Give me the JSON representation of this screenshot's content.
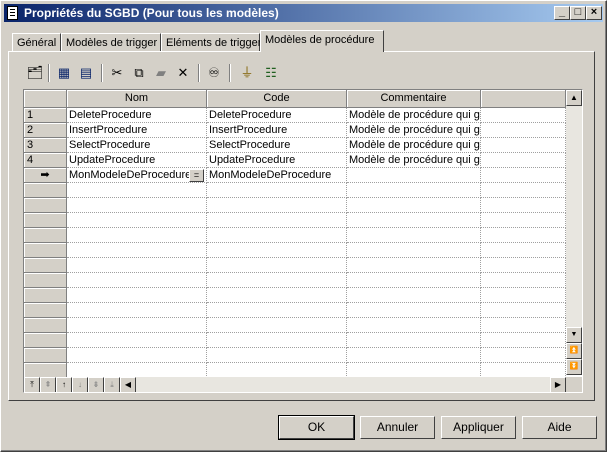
{
  "window": {
    "title": "Propriétés du SGBD (Pour tous les modèles)"
  },
  "tabs": [
    {
      "label": "Général"
    },
    {
      "label": "Modèles de trigger"
    },
    {
      "label": "Eléments de trigger"
    },
    {
      "label": "Modèles de procédure"
    }
  ],
  "active_tab": "Modèles de procédure",
  "toolbar": {
    "icons": [
      "properties-icon",
      "add-row-icon",
      "insert-row-icon",
      "cut-icon",
      "copy-icon",
      "paste-icon",
      "delete-icon",
      "find-icon",
      "filter-icon",
      "customize-columns-icon"
    ]
  },
  "table": {
    "columns": [
      "Nom",
      "Code",
      "Commentaire"
    ],
    "rows": [
      {
        "num": "1",
        "nom": "DeleteProcedure",
        "code": "DeleteProcedure",
        "commentaire": "Modèle de procédure qui g"
      },
      {
        "num": "2",
        "nom": "InsertProcedure",
        "code": "InsertProcedure",
        "commentaire": "Modèle de procédure qui g"
      },
      {
        "num": "3",
        "nom": "SelectProcedure",
        "code": "SelectProcedure",
        "commentaire": "Modèle de procédure qui g"
      },
      {
        "num": "4",
        "nom": "UpdateProcedure",
        "code": "UpdateProcedure",
        "commentaire": "Modèle de procédure qui g"
      },
      {
        "num": "➡",
        "nom": "MonModeleDeProcedure",
        "code": "MonModeleDeProcedure",
        "commentaire": ""
      }
    ],
    "edit_button_glyph": "="
  },
  "buttons": {
    "ok": "OK",
    "cancel": "Annuler",
    "apply": "Appliquer",
    "help": "Aide"
  }
}
